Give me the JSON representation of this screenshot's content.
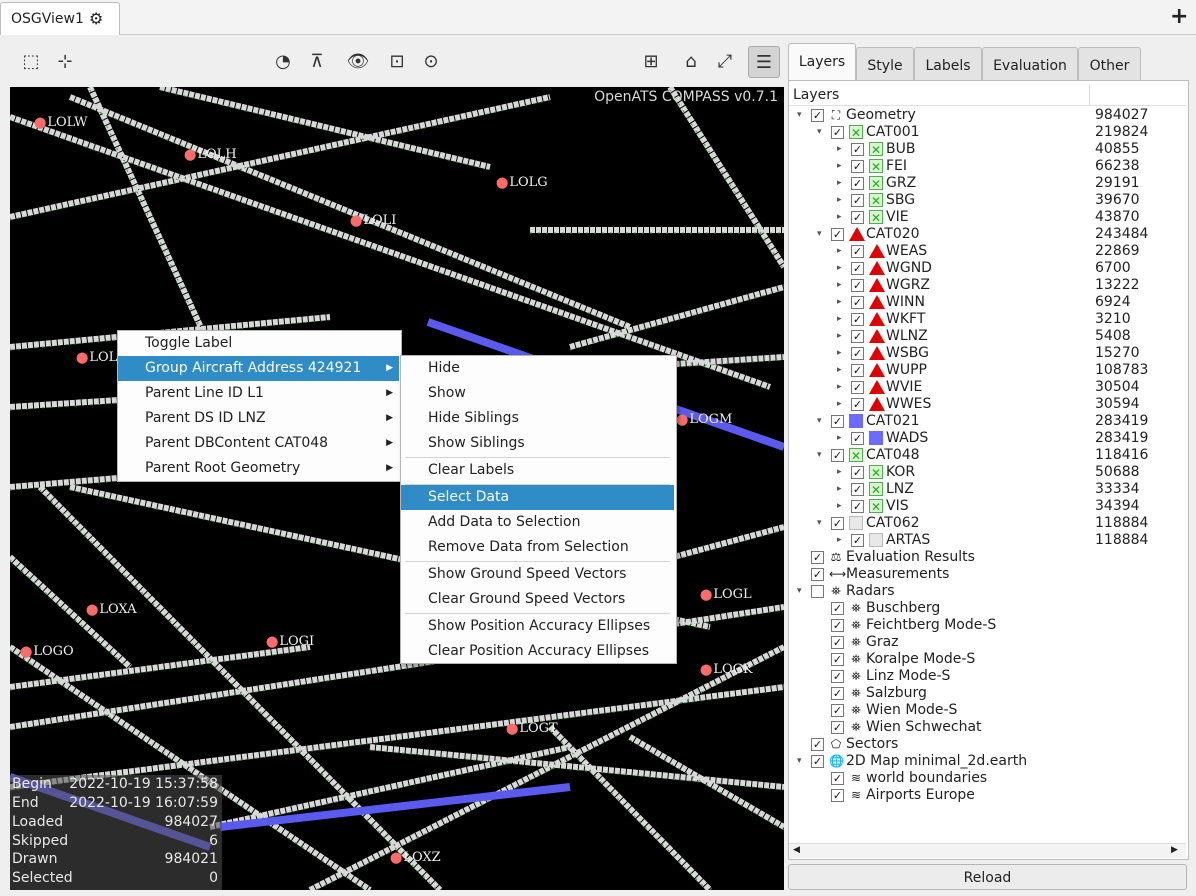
{
  "tab": {
    "title": "OSGView1",
    "gear_icon": "gear-icon",
    "add_icon": "+"
  },
  "map": {
    "version": "OpenATS COMPASS v0.7.1",
    "airports": [
      "LOLW",
      "LOLH",
      "LOLG",
      "LOLI",
      "LOL",
      "LOGM",
      "LOXA",
      "LOGL",
      "LOGI",
      "LOGO",
      "LOGK",
      "LOGT",
      "LOXZ"
    ]
  },
  "info": [
    {
      "key": "Begin",
      "value": "2022-10-19 15:37:58"
    },
    {
      "key": "End",
      "value": "2022-10-19 16:07:59"
    },
    {
      "key": "Loaded",
      "value": "984027"
    },
    {
      "key": "Skipped",
      "value": "6"
    },
    {
      "key": "Drawn",
      "value": "984021"
    },
    {
      "key": "Selected",
      "value": "0"
    }
  ],
  "menu1": [
    {
      "label": "Toggle Label",
      "sub": false
    },
    {
      "label": "Group Aircraft Address 424921",
      "sub": true,
      "highlight": true
    },
    {
      "label": "Parent Line ID L1",
      "sub": true
    },
    {
      "label": "Parent DS ID LNZ",
      "sub": true
    },
    {
      "label": "Parent DBContent CAT048",
      "sub": true
    },
    {
      "label": "Parent Root Geometry",
      "sub": true
    }
  ],
  "menu2": [
    {
      "label": "Hide"
    },
    {
      "label": "Show"
    },
    {
      "label": "Hide Siblings"
    },
    {
      "label": "Show Siblings"
    },
    {
      "label": "Clear Labels",
      "sep_before": true
    },
    {
      "label": "Select Data",
      "sep_before": true,
      "highlight": true
    },
    {
      "label": "Add Data to Selection"
    },
    {
      "label": "Remove Data from Selection"
    },
    {
      "label": "Show Ground Speed Vectors",
      "sep_before": true
    },
    {
      "label": "Clear Ground Speed Vectors"
    },
    {
      "label": "Show Position Accuracy Ellipses",
      "sep_before": true
    },
    {
      "label": "Clear Position Accuracy Ellipses"
    }
  ],
  "right_tabs": [
    "Layers",
    "Style",
    "Labels",
    "Evaluation",
    "Other"
  ],
  "tree_header": "Layers",
  "tree": [
    {
      "label": "Geometry",
      "count": "984027",
      "lvl": 0,
      "exp": "▾",
      "checked": true,
      "icon": "geometry"
    },
    {
      "label": "CAT001",
      "count": "219824",
      "lvl": 1,
      "exp": "▾",
      "checked": true,
      "icon": "x"
    },
    {
      "label": "BUB",
      "count": "40855",
      "lvl": 2,
      "exp": "▸",
      "checked": true,
      "icon": "x"
    },
    {
      "label": "FEI",
      "count": "66238",
      "lvl": 2,
      "exp": "▸",
      "checked": true,
      "icon": "x"
    },
    {
      "label": "GRZ",
      "count": "29191",
      "lvl": 2,
      "exp": "▸",
      "checked": true,
      "icon": "x"
    },
    {
      "label": "SBG",
      "count": "39670",
      "lvl": 2,
      "exp": "▸",
      "checked": true,
      "icon": "x"
    },
    {
      "label": "VIE",
      "count": "43870",
      "lvl": 2,
      "exp": "▸",
      "checked": true,
      "icon": "x"
    },
    {
      "label": "CAT020",
      "count": "243484",
      "lvl": 1,
      "exp": "▾",
      "checked": true,
      "icon": "tri"
    },
    {
      "label": "WEAS",
      "count": "22869",
      "lvl": 2,
      "exp": "▸",
      "checked": true,
      "icon": "tri"
    },
    {
      "label": "WGND",
      "count": "6700",
      "lvl": 2,
      "exp": "▸",
      "checked": true,
      "icon": "tri"
    },
    {
      "label": "WGRZ",
      "count": "13222",
      "lvl": 2,
      "exp": "▸",
      "checked": true,
      "icon": "tri"
    },
    {
      "label": "WINN",
      "count": "6924",
      "lvl": 2,
      "exp": "▸",
      "checked": true,
      "icon": "tri"
    },
    {
      "label": "WKFT",
      "count": "3210",
      "lvl": 2,
      "exp": "▸",
      "checked": true,
      "icon": "tri"
    },
    {
      "label": "WLNZ",
      "count": "5408",
      "lvl": 2,
      "exp": "▸",
      "checked": true,
      "icon": "tri"
    },
    {
      "label": "WSBG",
      "count": "15270",
      "lvl": 2,
      "exp": "▸",
      "checked": true,
      "icon": "tri"
    },
    {
      "label": "WUPP",
      "count": "108783",
      "lvl": 2,
      "exp": "▸",
      "checked": true,
      "icon": "tri"
    },
    {
      "label": "WVIE",
      "count": "30504",
      "lvl": 2,
      "exp": "▸",
      "checked": true,
      "icon": "tri"
    },
    {
      "label": "WWES",
      "count": "30594",
      "lvl": 2,
      "exp": "▸",
      "checked": true,
      "icon": "tri"
    },
    {
      "label": "CAT021",
      "count": "283419",
      "lvl": 1,
      "exp": "▾",
      "checked": true,
      "icon": "sq"
    },
    {
      "label": "WADS",
      "count": "283419",
      "lvl": 2,
      "exp": "▸",
      "checked": true,
      "icon": "sq"
    },
    {
      "label": "CAT048",
      "count": "118416",
      "lvl": 1,
      "exp": "▾",
      "checked": true,
      "icon": "x"
    },
    {
      "label": "KOR",
      "count": "50688",
      "lvl": 2,
      "exp": "▸",
      "checked": true,
      "icon": "x"
    },
    {
      "label": "LNZ",
      "count": "33334",
      "lvl": 2,
      "exp": "▸",
      "checked": true,
      "icon": "x"
    },
    {
      "label": "VIS",
      "count": "34394",
      "lvl": 2,
      "exp": "▸",
      "checked": true,
      "icon": "x"
    },
    {
      "label": "CAT062",
      "count": "118884",
      "lvl": 1,
      "exp": "▾",
      "checked": true,
      "icon": "wsq"
    },
    {
      "label": "ARTAS",
      "count": "118884",
      "lvl": 2,
      "exp": "▸",
      "checked": true,
      "icon": "wsq"
    },
    {
      "label": "Evaluation Results",
      "count": "",
      "lvl": 0,
      "exp": "",
      "checked": true,
      "icon": "scale"
    },
    {
      "label": "Measurements",
      "count": "",
      "lvl": 0,
      "exp": "",
      "checked": true,
      "icon": "measure"
    },
    {
      "label": "Radars",
      "count": "",
      "lvl": 0,
      "exp": "▾",
      "checked": false,
      "icon": "radar"
    },
    {
      "label": "Buschberg",
      "count": "",
      "lvl": 1,
      "exp": "",
      "checked": true,
      "icon": "radar"
    },
    {
      "label": "Feichtberg Mode-S",
      "count": "",
      "lvl": 1,
      "exp": "",
      "checked": true,
      "icon": "radar"
    },
    {
      "label": "Graz",
      "count": "",
      "lvl": 1,
      "exp": "",
      "checked": true,
      "icon": "radar"
    },
    {
      "label": "Koralpe Mode-S",
      "count": "",
      "lvl": 1,
      "exp": "",
      "checked": true,
      "icon": "radar"
    },
    {
      "label": "Linz Mode-S",
      "count": "",
      "lvl": 1,
      "exp": "",
      "checked": true,
      "icon": "radar"
    },
    {
      "label": "Salzburg",
      "count": "",
      "lvl": 1,
      "exp": "",
      "checked": true,
      "icon": "radar"
    },
    {
      "label": "Wien Mode-S",
      "count": "",
      "lvl": 1,
      "exp": "",
      "checked": true,
      "icon": "radar"
    },
    {
      "label": "Wien Schwechat",
      "count": "",
      "lvl": 1,
      "exp": "",
      "checked": true,
      "icon": "radar"
    },
    {
      "label": "Sectors",
      "count": "",
      "lvl": 0,
      "exp": "",
      "checked": true,
      "icon": "sector"
    },
    {
      "label": "2D Map minimal_2d.earth",
      "count": "",
      "lvl": 0,
      "exp": "▾",
      "checked": true,
      "icon": "globe"
    },
    {
      "label": "world boundaries",
      "count": "",
      "lvl": 1,
      "exp": "",
      "checked": true,
      "icon": "layers"
    },
    {
      "label": "Airports Europe",
      "count": "",
      "lvl": 1,
      "exp": "",
      "checked": true,
      "icon": "layers"
    }
  ],
  "reload_label": "Reload",
  "colors": {
    "highlight": "#308cc6",
    "cat020": "#e00000",
    "cat021": "#6b6bff"
  }
}
